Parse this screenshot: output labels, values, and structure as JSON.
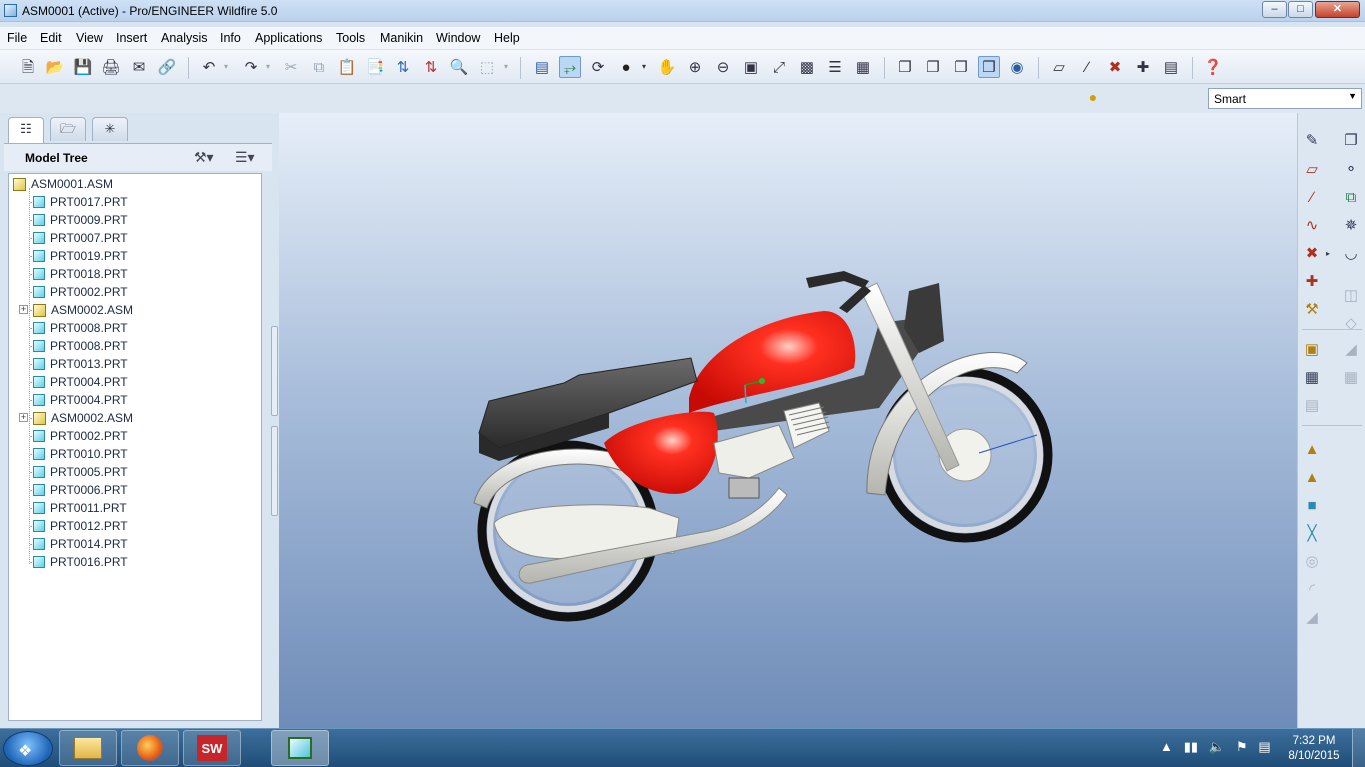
{
  "window": {
    "title": "ASM0001 (Active) - Pro/ENGINEER Wildfire 5.0"
  },
  "menu": [
    "File",
    "Edit",
    "View",
    "Insert",
    "Analysis",
    "Info",
    "Applications",
    "Tools",
    "Manikin",
    "Window",
    "Help"
  ],
  "filter": {
    "selected": "Smart"
  },
  "model_tree": {
    "title": "Model Tree",
    "root": "ASM0001.ASM",
    "items": [
      {
        "label": "PRT0017.PRT",
        "type": "part"
      },
      {
        "label": "PRT0009.PRT",
        "type": "part"
      },
      {
        "label": "PRT0007.PRT",
        "type": "part"
      },
      {
        "label": "PRT0019.PRT",
        "type": "part"
      },
      {
        "label": "PRT0018.PRT",
        "type": "part"
      },
      {
        "label": "PRT0002.PRT",
        "type": "part"
      },
      {
        "label": "ASM0002.ASM",
        "type": "asm"
      },
      {
        "label": "PRT0008.PRT",
        "type": "part"
      },
      {
        "label": "PRT0008.PRT",
        "type": "part"
      },
      {
        "label": "PRT0013.PRT",
        "type": "part"
      },
      {
        "label": "PRT0004.PRT",
        "type": "part"
      },
      {
        "label": "PRT0004.PRT",
        "type": "part"
      },
      {
        "label": "ASM0002.ASM",
        "type": "asm"
      },
      {
        "label": "PRT0002.PRT",
        "type": "part"
      },
      {
        "label": "PRT0010.PRT",
        "type": "part"
      },
      {
        "label": "PRT0005.PRT",
        "type": "part"
      },
      {
        "label": "PRT0006.PRT",
        "type": "part"
      },
      {
        "label": "PRT0011.PRT",
        "type": "part"
      },
      {
        "label": "PRT0012.PRT",
        "type": "part"
      },
      {
        "label": "PRT0014.PRT",
        "type": "part"
      },
      {
        "label": "PRT0016.PRT",
        "type": "part"
      }
    ]
  },
  "taskbar": {
    "sw_label": "SW",
    "time": "7:32 PM",
    "date": "8/10/2015"
  },
  "colors": {
    "tank_red": "#e4120c",
    "seat_gray": "#3a3a3a",
    "frame_gray": "#4a4a4a",
    "chrome": "#e8e8e2",
    "viewport_top": "#e6eef8",
    "viewport_bottom": "#6e8cb8"
  }
}
